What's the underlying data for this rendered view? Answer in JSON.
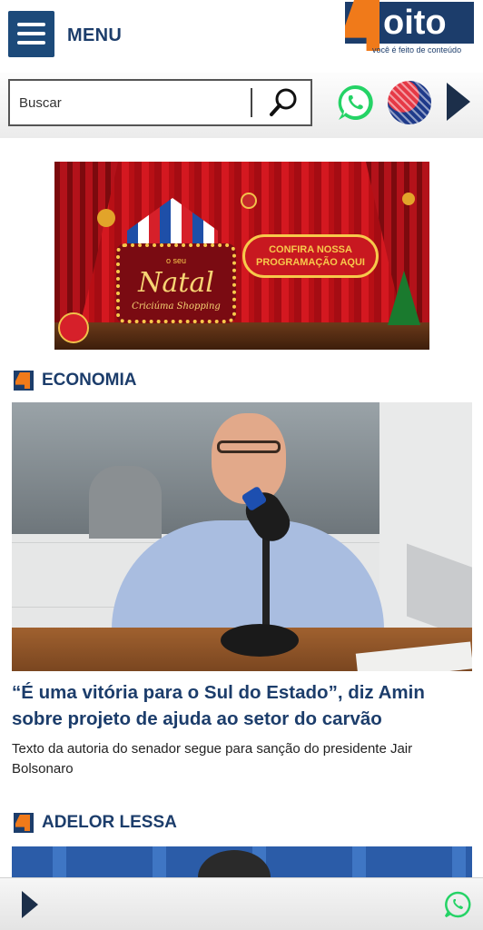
{
  "header": {
    "menu_label": "MENU",
    "logo": {
      "text": "oito",
      "tagline": "você é feito de conteúdo"
    }
  },
  "search": {
    "placeholder": "Buscar",
    "value": ""
  },
  "icons": {
    "menu": "hamburger-icon",
    "search": "magnifier-icon",
    "whatsapp": "whatsapp-icon",
    "globe": "globe-icon",
    "play": "play-icon"
  },
  "banner": {
    "cta_line1": "CONFIRA NOSSA",
    "cta_line2": "PROGRAMAÇÃO AQUI",
    "sign_small": "o seu",
    "sign_title": "Natal",
    "sign_sub": "Criciúma Shopping"
  },
  "sections": [
    {
      "title": "ECONOMIA",
      "article": {
        "headline": "“É uma vitória para o Sul do Estado”, diz Amin sobre projeto de ajuda ao setor do carvão",
        "summary": "Texto da autoria do senador segue para sanção do presidente Jair Bolsonaro"
      }
    },
    {
      "title": "ADELOR LESSA"
    }
  ],
  "colors": {
    "brand_blue": "#1c3d6b",
    "brand_orange": "#f07a1a",
    "whatsapp_green": "#25d366"
  }
}
